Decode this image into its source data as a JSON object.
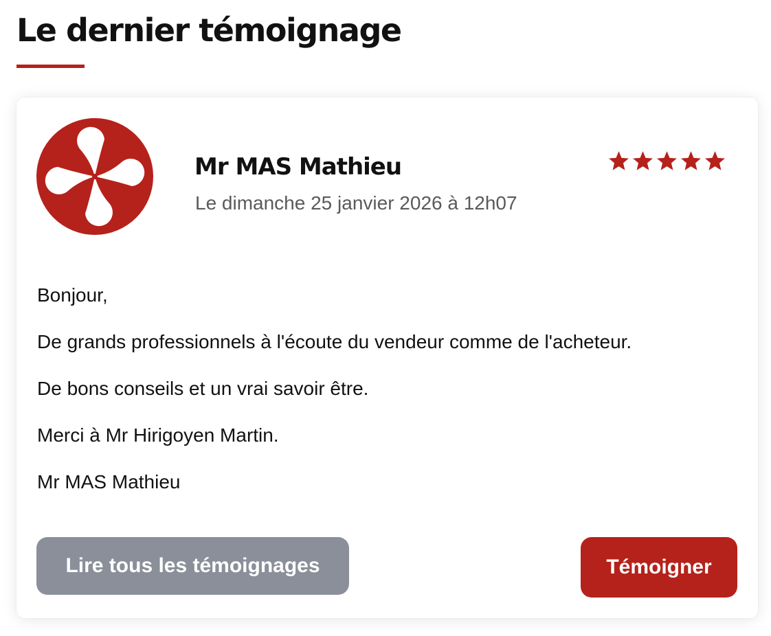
{
  "section": {
    "title": "Le dernier témoignage",
    "accent_color": "#b5221b"
  },
  "testimonial": {
    "avatar": {
      "icon": "basque-cross-lauburu-icon",
      "background_color": "#b5221b"
    },
    "author_name": "Mr MAS Mathieu",
    "date": "Le dimanche 25 janvier 2026 à 12h07",
    "rating": {
      "value": 5,
      "max": 5,
      "star_color": "#b5221b"
    },
    "message_lines": [
      "Bonjour,",
      "De grands professionnels à l'écoute du vendeur comme de l'acheteur.",
      "De bons conseils et un vrai savoir être.",
      "Merci à Mr Hirigoyen Martin.",
      "Mr MAS Mathieu"
    ]
  },
  "buttons": {
    "read_all_label": "Lire tous les témoignages",
    "read_all_color": "#8b8f99",
    "testify_label": "Témoigner",
    "testify_color": "#b5221b"
  }
}
